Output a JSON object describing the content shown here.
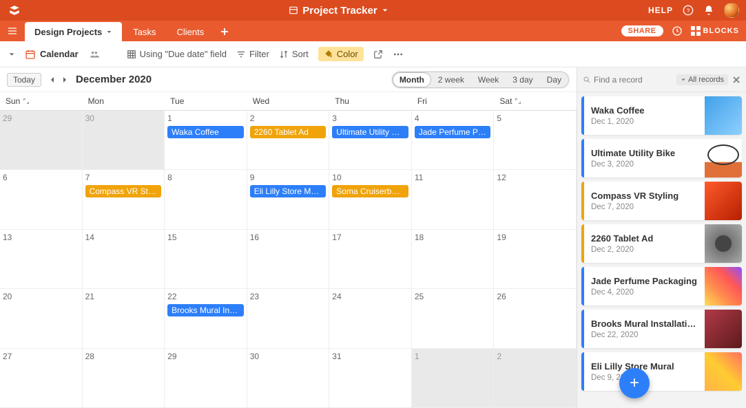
{
  "app": {
    "title": "Project Tracker"
  },
  "topbar": {
    "help": "HELP"
  },
  "tabs": {
    "items": [
      {
        "label": "Design Projects"
      },
      {
        "label": "Tasks"
      },
      {
        "label": "Clients"
      }
    ],
    "share": "SHARE",
    "blocks": "BLOCKS"
  },
  "viewbar": {
    "active_view": "Calendar",
    "using": "Using \"Due date\" field",
    "filter": "Filter",
    "sort": "Sort",
    "color": "Color"
  },
  "calendar": {
    "today_label": "Today",
    "month_label": "December 2020",
    "segments": [
      "Month",
      "2 week",
      "Week",
      "3 day",
      "Day"
    ],
    "day_names": [
      "Sun",
      "Mon",
      "Tue",
      "Wed",
      "Thu",
      "Fri",
      "Sat"
    ],
    "cells": [
      {
        "n": "29",
        "out": true
      },
      {
        "n": "30",
        "out": true
      },
      {
        "n": "1",
        "evts": [
          {
            "t": "Waka Coffee",
            "c": "blue"
          }
        ]
      },
      {
        "n": "2",
        "evts": [
          {
            "t": "2260 Tablet Ad",
            "c": "orange"
          }
        ]
      },
      {
        "n": "3",
        "evts": [
          {
            "t": "Ultimate Utility Bike",
            "c": "blue"
          }
        ]
      },
      {
        "n": "4",
        "evts": [
          {
            "t": "Jade Perfume Pac...",
            "c": "blue"
          }
        ]
      },
      {
        "n": "5"
      },
      {
        "n": "6"
      },
      {
        "n": "7",
        "evts": [
          {
            "t": "Compass VR Styli...",
            "c": "orange"
          }
        ]
      },
      {
        "n": "8"
      },
      {
        "n": "9",
        "evts": [
          {
            "t": "Eli Lilly Store Mural",
            "c": "blue"
          }
        ]
      },
      {
        "n": "10",
        "evts": [
          {
            "t": "Soma Cruiserboard",
            "c": "orange"
          }
        ]
      },
      {
        "n": "11"
      },
      {
        "n": "12"
      },
      {
        "n": "13"
      },
      {
        "n": "14"
      },
      {
        "n": "15"
      },
      {
        "n": "16"
      },
      {
        "n": "17"
      },
      {
        "n": "18"
      },
      {
        "n": "19"
      },
      {
        "n": "20"
      },
      {
        "n": "21"
      },
      {
        "n": "22",
        "evts": [
          {
            "t": "Brooks Mural Inst...",
            "c": "blue"
          }
        ]
      },
      {
        "n": "23"
      },
      {
        "n": "24"
      },
      {
        "n": "25"
      },
      {
        "n": "26"
      },
      {
        "n": "27"
      },
      {
        "n": "28"
      },
      {
        "n": "29"
      },
      {
        "n": "30"
      },
      {
        "n": "31"
      },
      {
        "n": "1",
        "out": true
      },
      {
        "n": "2",
        "out": true
      }
    ]
  },
  "sidepanel": {
    "search_placeholder": "Find a record",
    "filter_label": "All records",
    "records": [
      {
        "title": "Waka Coffee",
        "date": "Dec 1, 2020",
        "color": "blue",
        "thumb": "t1"
      },
      {
        "title": "Ultimate Utility Bike",
        "date": "Dec 3, 2020",
        "color": "blue",
        "thumb": "t2"
      },
      {
        "title": "Compass VR Styling",
        "date": "Dec 7, 2020",
        "color": "orange",
        "thumb": "t3"
      },
      {
        "title": "2260 Tablet Ad",
        "date": "Dec 2, 2020",
        "color": "orange",
        "thumb": "t4"
      },
      {
        "title": "Jade Perfume Packaging",
        "date": "Dec 4, 2020",
        "color": "blue",
        "thumb": "t5"
      },
      {
        "title": "Brooks Mural Installation",
        "date": "Dec 22, 2020",
        "color": "blue",
        "thumb": "t6"
      },
      {
        "title": "Eli Lilly Store Mural",
        "date": "Dec 9, 2020",
        "color": "blue",
        "thumb": "t7"
      }
    ]
  }
}
